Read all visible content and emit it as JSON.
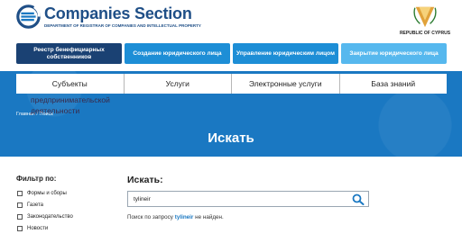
{
  "header": {
    "logo_title": "Companies Section",
    "logo_subtitle": "DEPARTMENT OF REGISTRAR OF COMPANIES AND INTELLECTUAL PROPERTY",
    "emblem_label": "REPUBLIC OF CYPRUS"
  },
  "actions": [
    {
      "label": "Реестр бенефициарных собственников"
    },
    {
      "label": "Создание юридического лица"
    },
    {
      "label": "Управление юридическим лицом"
    },
    {
      "label": "Закрытие юридического лица"
    }
  ],
  "nav": {
    "items": [
      {
        "label": "Субъекты"
      },
      {
        "label": "Услуги"
      },
      {
        "label": "Электронные услуги"
      },
      {
        "label": "База знаний"
      }
    ],
    "overflow_text": "предпринимательской деятельности"
  },
  "breadcrumb": {
    "home": "Главная",
    "separator": "/",
    "current": "Поиск"
  },
  "page_title": "Искать",
  "filter": {
    "title": "Фильтр по:",
    "items": [
      {
        "label": "Формы и сборы"
      },
      {
        "label": "Газета"
      },
      {
        "label": "Законодательство"
      },
      {
        "label": "Новости"
      }
    ]
  },
  "search": {
    "label": "Искать:",
    "value": "tylineir",
    "result_prefix": "Поиск по запросу",
    "result_term": "tylineir",
    "result_suffix": "не найден."
  },
  "colors": {
    "brand_dark": "#1a4173",
    "brand_blue": "#1d8ed6",
    "band_blue": "#1a78c2",
    "light_blue": "#56b8ee"
  }
}
